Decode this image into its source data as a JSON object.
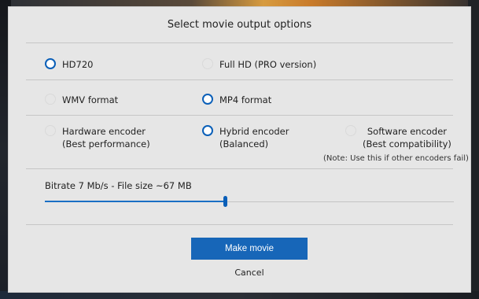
{
  "dialog": {
    "title": "Select movie output options",
    "resolution": {
      "hd720": {
        "label": "HD720",
        "selected": true,
        "enabled": true
      },
      "fullhd": {
        "label": "Full HD (PRO version)",
        "selected": false,
        "enabled": false
      }
    },
    "format": {
      "wmv": {
        "label": "WMV format",
        "selected": false,
        "enabled": false
      },
      "mp4": {
        "label": "MP4 format",
        "selected": true,
        "enabled": true
      }
    },
    "encoder": {
      "hardware": {
        "label": "Hardware encoder",
        "sub": "(Best performance)",
        "selected": false
      },
      "hybrid": {
        "label": "Hybrid encoder",
        "sub": "(Balanced)",
        "selected": true
      },
      "software": {
        "label": "Software encoder",
        "sub": "(Best compatibility)",
        "selected": false
      },
      "note": "(Note: Use this if other encoders fail)"
    },
    "bitrate": {
      "label": "Bitrate 7 Mb/s - File size ~67 MB",
      "value_fraction": 0.44
    },
    "make_movie_label": "Make movie",
    "cancel_label": "Cancel"
  },
  "colors": {
    "accent": "#1766b8",
    "dialog_bg": "#e6e6e6"
  }
}
